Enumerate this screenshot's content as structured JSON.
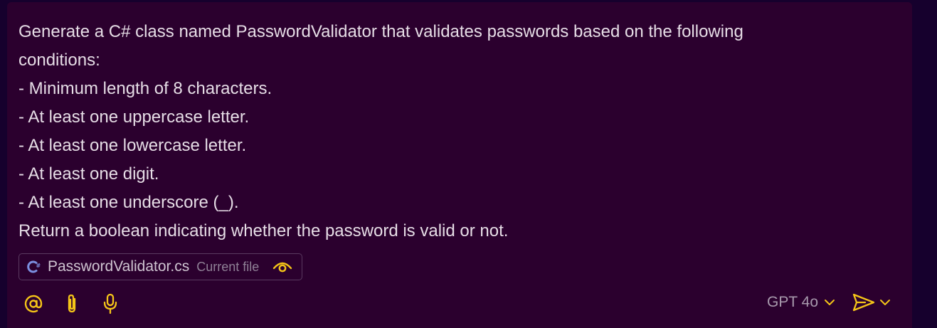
{
  "prompt": {
    "lines": [
      "Generate a C# class named PasswordValidator that validates passwords based on the following",
      "conditions:",
      "- Minimum length of 8 characters.",
      "- At least one uppercase letter.",
      "- At least one lowercase letter.",
      "- At least one digit.",
      "- At least one underscore (_).",
      "Return a boolean indicating whether the password is valid or not."
    ]
  },
  "context": {
    "file_name": "PasswordValidator.cs",
    "file_tag": "Current file",
    "file_icon": "csharp-file-icon",
    "visibility_icon": "eye-icon"
  },
  "toolbar": {
    "mention_icon": "at-sign-icon",
    "attach_icon": "paperclip-icon",
    "voice_icon": "microphone-icon",
    "model_label": "GPT 4o",
    "send_icon": "send-icon"
  },
  "colors": {
    "background": "#16002d",
    "panel": "#2b002e",
    "accent": "#f5c518",
    "text": "#e6dde6",
    "muted_text": "#a89aad",
    "chip_border": "#5a3a60",
    "csharp_icon": "#7b8fe0"
  }
}
